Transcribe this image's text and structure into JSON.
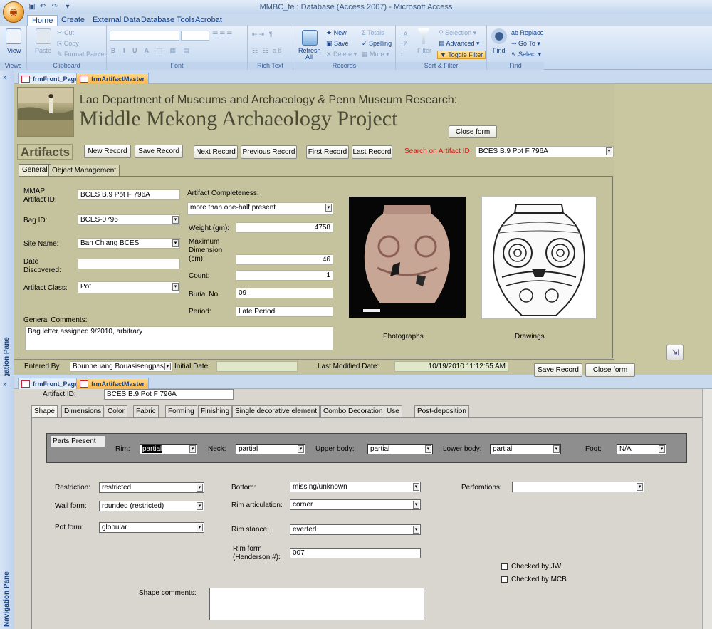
{
  "window": {
    "title": "MMBC_fe : Database (Access 2007) - Microsoft Access"
  },
  "ribbon": {
    "tabs": [
      "Home",
      "Create",
      "External Data",
      "Database Tools",
      "Acrobat"
    ],
    "views": {
      "view": "View",
      "label": "Views"
    },
    "clipboard": {
      "paste": "Paste",
      "cut": "Cut",
      "copy": "Copy",
      "format_painter": "Format Painter",
      "label": "Clipboard"
    },
    "font": {
      "label": "Font"
    },
    "rich_text": {
      "label": "Rich Text"
    },
    "records": {
      "refresh": "Refresh All",
      "new": "New",
      "save": "Save",
      "delete": "Delete",
      "totals": "Totals",
      "spelling": "Spelling",
      "more": "More",
      "label": "Records"
    },
    "sort_filter": {
      "filter": "Filter",
      "selection": "Selection",
      "advanced": "Advanced",
      "toggle_filter": "Toggle Filter",
      "label": "Sort & Filter"
    },
    "find": {
      "find": "Find",
      "replace": "Replace",
      "goto": "Go To",
      "select": "Select",
      "label": "Find"
    }
  },
  "nav_pane": {
    "label": "Navigation Pane"
  },
  "doc_tabs": {
    "front": "frmFront_Page",
    "master": "frmArtifactMaster"
  },
  "form1": {
    "banner_line1": "Lao Department of Museums and Archaeology & Penn Museum Research:",
    "banner_line2": "Middle Mekong Archaeology Project",
    "close_form": "Close form",
    "section_title": "Artifacts",
    "buttons": {
      "new_record": "New Record",
      "save_record": "Save Record",
      "next_record": "Next Record",
      "previous_record": "Previous Record",
      "first_record": "First Record",
      "last_record": "Last Record"
    },
    "search_label": "Search on Artifact ID",
    "search_value": "BCES B.9 Pot F 796A",
    "tabs": {
      "general": "General",
      "object_management": "Object Management"
    },
    "fields": {
      "mmap_artifact_id_label": "MMAP Artifact ID:",
      "mmap_artifact_id": "BCES B.9 Pot F 796A",
      "bag_id_label": "Bag ID:",
      "bag_id": "BCES-0796",
      "site_name_label": "Site Name:",
      "site_name": "Ban Chiang BCES",
      "date_discovered_label": "Date Discovered:",
      "date_discovered": "",
      "artifact_class_label": "Artifact Class:",
      "artifact_class": "Pot",
      "completeness_label": "Artifact Completeness:",
      "completeness": "more than one-half present",
      "weight_label": "Weight (gm):",
      "weight": "4758",
      "max_dim_label": "Maximum Dimension (cm):",
      "max_dim": "46",
      "count_label": "Count:",
      "count": "1",
      "burial_no_label": "Burial No:",
      "burial_no": "09",
      "period_label": "Period:",
      "period": "Late Period",
      "general_comments_label": "General Comments:",
      "general_comments": "Bag letter assigned 9/2010, arbitrary"
    },
    "photographs_label": "Photographs",
    "drawings_label": "Drawings",
    "footer": {
      "entered_by_label": "Entered By",
      "entered_by": "Bounheuang Bouasisengpase",
      "initial_date_label": "Initial Date:",
      "initial_date": "",
      "last_modified_label": "Last Modified Date:",
      "last_modified": "10/19/2010 11:12:55 AM",
      "save_record": "Save Record",
      "close_form": "Close form"
    }
  },
  "form2": {
    "artifact_id_label": "Artifact ID:",
    "artifact_id": "BCES B.9 Pot F 796A",
    "tabs": [
      "Shape",
      "Dimensions",
      "Color",
      "Fabric",
      "Forming",
      "Finishing",
      "Single decorative element",
      "Combo Decoration",
      "Use",
      "Post-deposition"
    ],
    "parts_present": {
      "title": "Parts Present",
      "rim_label": "Rim:",
      "rim": "partial",
      "neck_label": "Neck:",
      "neck": "partial",
      "upper_label": "Upper body:",
      "upper": "partial",
      "lower_label": "Lower body:",
      "lower": "partial",
      "foot_label": "Foot:",
      "foot": "N/A"
    },
    "restriction_label": "Restriction:",
    "restriction": "restricted",
    "wall_form_label": "Wall form:",
    "wall_form": "rounded (restricted)",
    "pot_form_label": "Pot form:",
    "pot_form": "globular",
    "bottom_label": "Bottom:",
    "bottom": "missing/unknown",
    "rim_artic_label": "Rim articulation:",
    "rim_artic": "corner",
    "rim_stance_label": "Rim stance:",
    "rim_stance": "everted",
    "rim_form_label": "Rim form (Henderson #):",
    "rim_form": "007",
    "perforations_label": "Perforations:",
    "perforations": "",
    "checked_jw": "Checked by JW",
    "checked_mcb": "Checked by MCB",
    "shape_comments_label": "Shape comments:",
    "shape_comments": ""
  }
}
